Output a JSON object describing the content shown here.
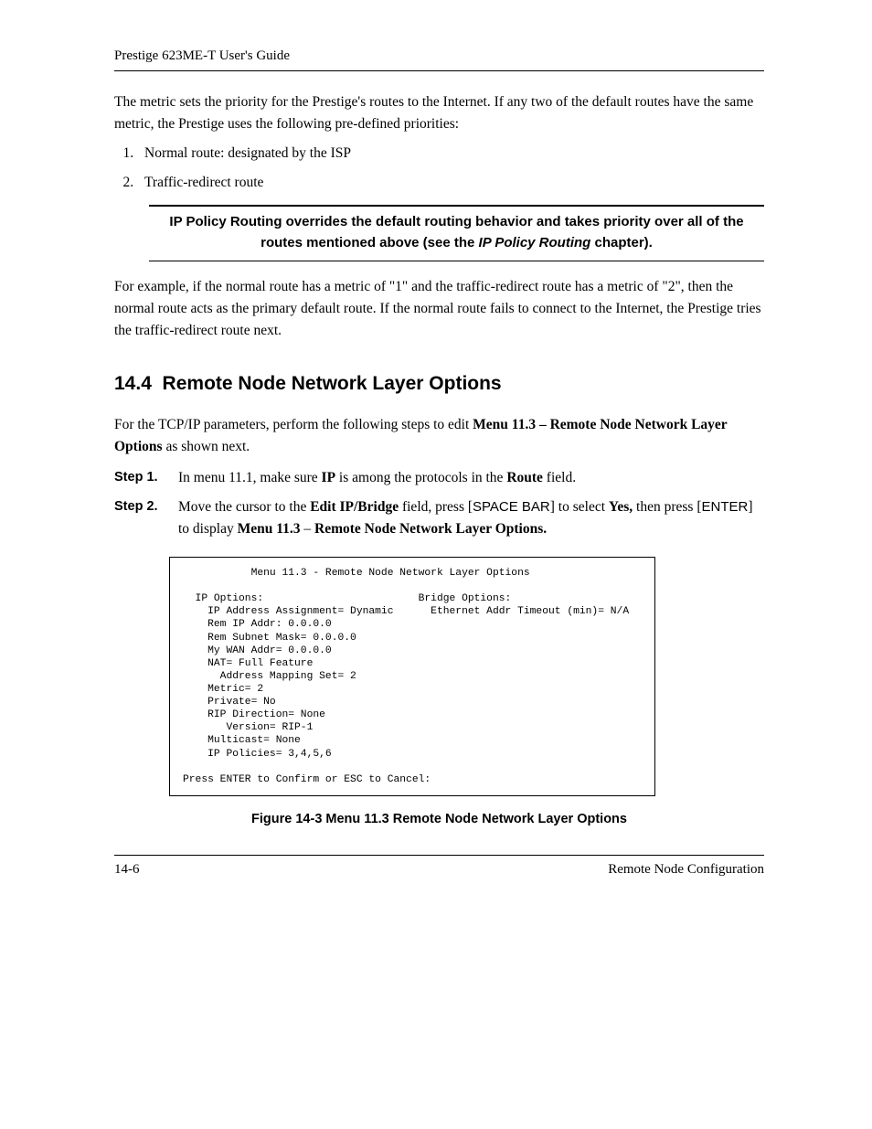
{
  "header": {
    "title": "Prestige 623ME-T User's Guide"
  },
  "body": {
    "intro": "The metric sets the priority for the Prestige's routes to the Internet. If any two of the default routes have the same metric, the Prestige uses the following pre-defined priorities:",
    "priorities": [
      "Normal route: designated by the ISP",
      "Traffic-redirect route"
    ],
    "callout": {
      "pre": "IP Policy Routing overrides the default routing behavior and takes priority over all of the routes mentioned above (see the ",
      "ital": "IP Policy Routing",
      "post": " chapter)."
    },
    "example": "For example, if the normal route has a metric of \"1\" and the traffic-redirect route has a metric of \"2\", then the normal route acts as the primary default route. If the normal route fails to connect to the Internet, the Prestige tries the traffic-redirect route next."
  },
  "section": {
    "number": "14.4",
    "title": "Remote Node Network Layer Options",
    "lead_pre": "For the TCP/IP parameters, perform the following steps to edit ",
    "lead_bold": "Menu 11.3 – Remote Node Network Layer Options",
    "lead_post": " as shown next.",
    "steps": [
      {
        "label": "Step 1.",
        "parts": [
          {
            "t": "In menu 11.1, make sure "
          },
          {
            "t": "IP",
            "b": true
          },
          {
            "t": " is among the protocols in the "
          },
          {
            "t": "Route",
            "b": true
          },
          {
            "t": " field."
          }
        ]
      },
      {
        "label": "Step 2.",
        "parts": [
          {
            "t": "Move the cursor to the "
          },
          {
            "t": "Edit IP/Bridge",
            "b": true
          },
          {
            "t": " field, press ["
          },
          {
            "t": "SPACE BAR",
            "sans": true
          },
          {
            "t": "] to select "
          },
          {
            "t": "Yes,",
            "b": true
          },
          {
            "t": " then press ["
          },
          {
            "t": "ENTER",
            "sans": true
          },
          {
            "t": "] to display "
          },
          {
            "t": "Menu 11.3",
            "b": true
          },
          {
            "t": " – "
          },
          {
            "t": "Remote Node Network Layer Options.",
            "b": true
          }
        ]
      }
    ]
  },
  "screen": {
    "title": "Menu 11.3 - Remote Node Network Layer Options",
    "left_header": "IP Options:",
    "right_header": "Bridge Options:",
    "row1_left": "IP Address Assignment= Dynamic",
    "row1_right": "Ethernet Addr Timeout (min)= N/A",
    "lines": [
      "Rem IP Addr: 0.0.0.0",
      "Rem Subnet Mask= 0.0.0.0",
      "My WAN Addr= 0.0.0.0",
      "NAT= Full Feature",
      "  Address Mapping Set= 2",
      "Metric= 2",
      "Private= No",
      "RIP Direction= None",
      "   Version= RIP-1",
      "Multicast= None",
      "IP Policies= 3,4,5,6"
    ],
    "footer": "Press ENTER to Confirm or ESC to Cancel:"
  },
  "figure_caption": "Figure 14-3 Menu 11.3 Remote Node Network Layer Options",
  "footer": {
    "left": "14-6",
    "right": "Remote Node Configuration"
  }
}
